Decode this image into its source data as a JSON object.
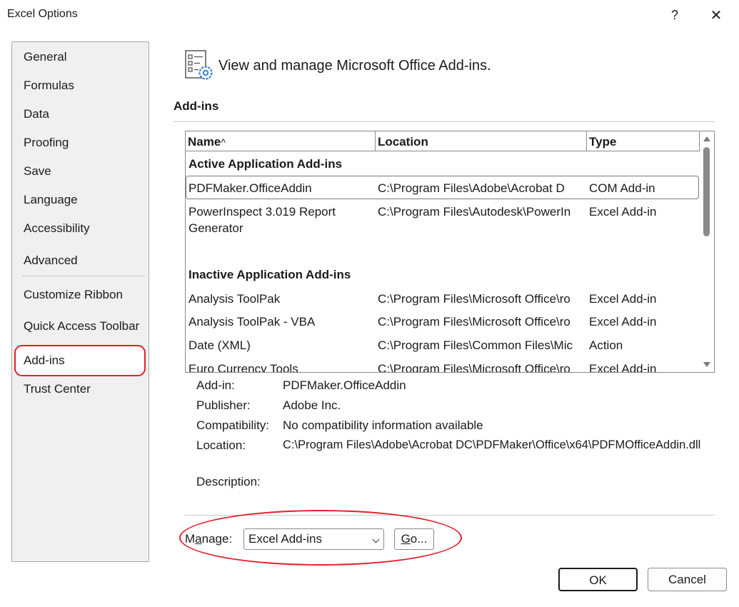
{
  "window": {
    "title": "Excel Options",
    "help_glyph": "?",
    "close_glyph": "✕"
  },
  "sidebar": {
    "items": [
      {
        "label": "General"
      },
      {
        "label": "Formulas"
      },
      {
        "label": "Data"
      },
      {
        "label": "Proofing"
      },
      {
        "label": "Save"
      },
      {
        "label": "Language"
      },
      {
        "label": "Accessibility"
      },
      {
        "label": "Advanced"
      },
      {
        "label": "Customize Ribbon"
      },
      {
        "label": "Quick Access Toolbar"
      },
      {
        "label": "Add-ins"
      },
      {
        "label": "Trust Center"
      }
    ],
    "selected": "Add-ins"
  },
  "header": {
    "icon": "addins-settings-icon",
    "text": "View and manage Microsoft Office Add-ins."
  },
  "section": {
    "title": "Add-ins"
  },
  "table": {
    "columns": [
      {
        "label": "Name",
        "sort_glyph": "^"
      },
      {
        "label": "Location"
      },
      {
        "label": "Type"
      }
    ],
    "groups": [
      {
        "title": "Active Application Add-ins",
        "rows": [
          {
            "name": "PDFMaker.OfficeAddin",
            "location": "C:\\Program Files\\Adobe\\Acrobat D",
            "type": "COM Add-in"
          },
          {
            "name": "PowerInspect 3.019 Report",
            "name2": "Generator",
            "location": "C:\\Program Files\\Autodesk\\PowerIn",
            "type": "Excel Add-in"
          }
        ]
      },
      {
        "title": "Inactive Application Add-ins",
        "rows": [
          {
            "name": "Analysis ToolPak",
            "location": "C:\\Program Files\\Microsoft Office\\ro",
            "type": "Excel Add-in"
          },
          {
            "name": "Analysis ToolPak - VBA",
            "location": "C:\\Program Files\\Microsoft Office\\ro",
            "type": "Excel Add-in"
          },
          {
            "name": "Date (XML)",
            "location": "C:\\Program Files\\Common Files\\Mic",
            "type": "Action"
          },
          {
            "name": "Euro Currency Tools",
            "location": "C:\\Program Files\\Microsoft Office\\ro",
            "type": "Excel Add-in"
          }
        ]
      }
    ]
  },
  "details": {
    "addin_label": "Add-in:",
    "addin_value": "PDFMaker.OfficeAddin",
    "publisher_label": "Publisher:",
    "publisher_value": "Adobe Inc.",
    "compat_label": "Compatibility:",
    "compat_value": "No compatibility information available",
    "location_label": "Location:",
    "location_value": "C:\\Program Files\\Adobe\\Acrobat DC\\PDFMaker\\Office\\x64\\PDFMOfficeAddin.dll",
    "description_label": "Description:"
  },
  "manage": {
    "label_pre": "M",
    "label_accel": "a",
    "label_post": "nage:",
    "selected": "Excel Add-ins",
    "go_accel": "G",
    "go_rest": "o..."
  },
  "footer": {
    "ok": "OK",
    "cancel": "Cancel"
  },
  "colors": {
    "highlight_red": "#e0202a",
    "sidebar_bg": "#f0f0f0"
  }
}
